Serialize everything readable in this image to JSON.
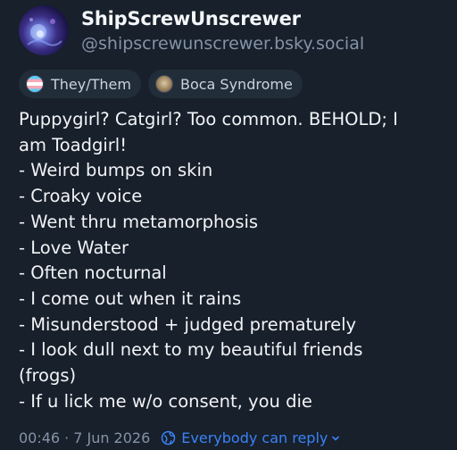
{
  "author": {
    "display_name": "ShipScrewUnscrewer",
    "handle": "@shipscrewunscrewer.bsky.social",
    "avatar_icon": "avatar-image"
  },
  "badges": [
    {
      "label": "They/Them",
      "icon": "pride-flag-icon"
    },
    {
      "label": "Boca Syndrome",
      "icon": "boca-icon"
    }
  ],
  "post": {
    "lines": [
      "Puppygirl? Catgirl? Too common. BEHOLD; I",
      "am Toadgirl!",
      "- Weird bumps on skin",
      "- Croaky voice",
      "- Went thru metamorphosis",
      "- Love Water",
      "- Often nocturnal",
      "- I come out when it rains",
      "- Misunderstood + judged prematurely",
      "- I look dull next to my beautiful friends",
      "(frogs)",
      "- If u lick me w/o consent, you die"
    ]
  },
  "meta": {
    "time": "00:46",
    "separator": "·",
    "date": "7 Jun 2026",
    "reply_setting": "Everybody can reply"
  },
  "colors": {
    "background": "#17202b",
    "accent": "#3b82f6",
    "muted": "#8593a6"
  }
}
